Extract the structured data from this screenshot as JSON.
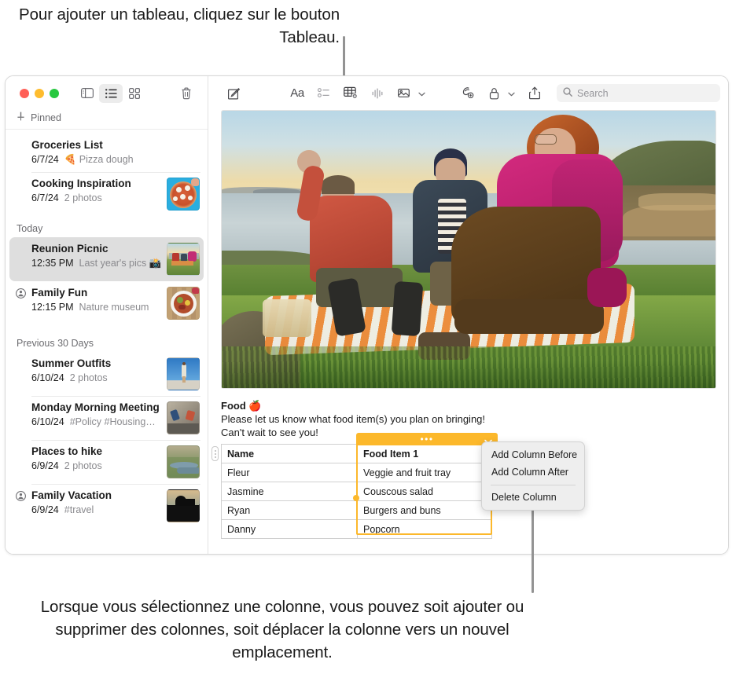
{
  "callouts": {
    "top": "Pour ajouter un tableau, cliquez sur le bouton Tableau.",
    "bottom": "Lorsque vous sélectionnez une colonne, vous pouvez soit ajouter ou supprimer des colonnes, soit déplacer la colonne vers un nouvel emplacement."
  },
  "sidebar": {
    "pinned_label": "Pinned",
    "groups": [
      {
        "label": "Today"
      },
      {
        "label": "Previous 30 Days"
      }
    ],
    "notes": [
      {
        "title": "Groceries List",
        "date": "6/7/24",
        "snippet": "🍕 Pizza dough",
        "thumb": false,
        "shared": false,
        "selected": false
      },
      {
        "title": "Cooking Inspiration",
        "date": "6/7/24",
        "snippet": "2 photos",
        "thumb": true,
        "shared": false,
        "selected": false
      },
      {
        "title": "Reunion Picnic",
        "date": "12:35 PM",
        "snippet": "Last year's pics 📸",
        "thumb": true,
        "shared": false,
        "selected": true
      },
      {
        "title": "Family Fun",
        "date": "12:15 PM",
        "snippet": "Nature museum",
        "thumb": true,
        "shared": true,
        "selected": false
      },
      {
        "title": "Summer Outfits",
        "date": "6/10/24",
        "snippet": "2 photos",
        "thumb": true,
        "shared": false,
        "selected": false
      },
      {
        "title": "Monday Morning Meeting",
        "date": "6/10/24",
        "snippet": "#Policy #Housing…",
        "thumb": true,
        "shared": false,
        "selected": false
      },
      {
        "title": "Places to hike",
        "date": "6/9/24",
        "snippet": "2 photos",
        "thumb": true,
        "shared": false,
        "selected": false
      },
      {
        "title": "Family Vacation",
        "date": "6/9/24",
        "snippet": "#travel",
        "thumb": true,
        "shared": true,
        "selected": false
      }
    ]
  },
  "toolbar": {
    "sidebar_icon": "sidebar-icon",
    "list_view_icon": "list-view-icon",
    "gallery_view_icon": "gallery-view-icon",
    "delete_icon": "trash-icon",
    "compose_icon": "compose-icon",
    "format_icon": "format-Aa-icon",
    "checklist_icon": "checklist-icon",
    "table_icon": "table-icon",
    "audio_icon": "audio-waveform-icon",
    "media_icon": "media-icon",
    "markup_icon": "markup-icon",
    "lock_icon": "lock-icon",
    "share_icon": "share-icon"
  },
  "search": {
    "placeholder": "Search",
    "value": "",
    "icon": "search-icon"
  },
  "note": {
    "heading": "Food 🍎",
    "line1": "Please let us know what food item(s) you plan on bringing!",
    "line2": "Can't wait to see you!"
  },
  "table": {
    "headers": [
      "Name",
      "Food Item 1"
    ],
    "rows": [
      [
        "Fleur",
        "Veggie and fruit tray"
      ],
      [
        "Jasmine",
        "Couscous salad"
      ],
      [
        "Ryan",
        "Burgers and buns"
      ],
      [
        "Danny",
        "Popcorn"
      ]
    ],
    "selected_column_index": 1,
    "selection_color": "#fcb82b",
    "handle_dots": "⋮"
  },
  "context_menu": {
    "items": [
      {
        "label": "Add Column Before",
        "separator_after": false
      },
      {
        "label": "Add Column After",
        "separator_after": true
      },
      {
        "label": "Delete Column",
        "separator_after": false
      }
    ]
  }
}
